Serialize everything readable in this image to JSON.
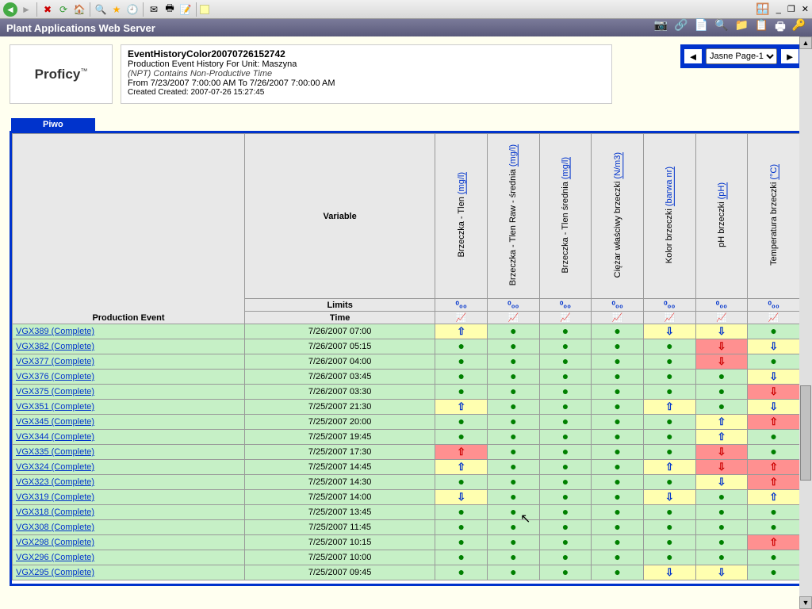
{
  "toolbar": {
    "back": "◄",
    "fwd": "►",
    "stop": "✖",
    "refresh": "⟳",
    "home": "🏠",
    "search": "🔍",
    "fav": "★",
    "hist": "🕘",
    "mail": "✉",
    "print": "🖶",
    "edit": "📝",
    "note": "▢"
  },
  "titlebar": {
    "text": "Plant Applications Web Server",
    "icons": [
      "📷",
      "🔗",
      "📄",
      "🔍",
      "📁",
      "📋",
      "🖶",
      "🔑"
    ]
  },
  "logo": "Proficy",
  "meta": {
    "title": "EventHistoryColor20070726152742",
    "line1": "Production Event History For Unit: Maszyna",
    "line2": "(NPT) Contains Non-Productive Time",
    "line3": "From 7/23/2007 7:00:00 AM To 7/26/2007 7:00:00 AM",
    "line4": "Created Created: 2007-07-26 15:27:45"
  },
  "pager": {
    "selected": "Jasne Page-1"
  },
  "tab": "Piwo",
  "headers": {
    "variable": "Variable",
    "limits": "Limits",
    "prod_event": "Production Event",
    "time": "Time",
    "cols": [
      {
        "name": "Brzeczka - Tlen",
        "unit": "(mg/l)"
      },
      {
        "name": "Brzeczka - Tlen Raw - średnia",
        "unit": "(mg/l)"
      },
      {
        "name": "Brzeczka - Tlen średnia",
        "unit": "(mg/l)"
      },
      {
        "name": "Ciężar właściwy brzeczki",
        "unit": "(N/m3)"
      },
      {
        "name": "Kolor brzeczki",
        "unit": "(barwa nr)"
      },
      {
        "name": "pH brzeczki",
        "unit": "(pH)"
      },
      {
        "name": "Temperatura brzeczki",
        "unit": "(°C)"
      }
    ],
    "lim_icon": "⁰₀₀",
    "chart_icon": "📈"
  },
  "rows": [
    {
      "ev": "VGX389 (Complete)",
      "tm": "7/26/2007 07:00",
      "c": [
        [
          "y",
          "u"
        ],
        [
          "g",
          "d"
        ],
        [
          "g",
          "d"
        ],
        [
          "g",
          "d"
        ],
        [
          "y",
          "v"
        ],
        [
          "y",
          "v"
        ],
        [
          "g",
          "d"
        ]
      ]
    },
    {
      "ev": "VGX382 (Complete)",
      "tm": "7/26/2007 05:15",
      "c": [
        [
          "g",
          "d"
        ],
        [
          "g",
          "d"
        ],
        [
          "g",
          "d"
        ],
        [
          "g",
          "d"
        ],
        [
          "g",
          "d"
        ],
        [
          "r",
          "r"
        ],
        [
          "y",
          "v"
        ]
      ]
    },
    {
      "ev": "VGX377 (Complete)",
      "tm": "7/26/2007 04:00",
      "c": [
        [
          "g",
          "d"
        ],
        [
          "g",
          "d"
        ],
        [
          "g",
          "d"
        ],
        [
          "g",
          "d"
        ],
        [
          "g",
          "d"
        ],
        [
          "r",
          "r"
        ],
        [
          "g",
          "d"
        ]
      ]
    },
    {
      "ev": "VGX376 (Complete)",
      "tm": "7/26/2007 03:45",
      "c": [
        [
          "g",
          "d"
        ],
        [
          "g",
          "d"
        ],
        [
          "g",
          "d"
        ],
        [
          "g",
          "d"
        ],
        [
          "g",
          "d"
        ],
        [
          "g",
          "d"
        ],
        [
          "y",
          "v"
        ]
      ]
    },
    {
      "ev": "VGX375 (Complete)",
      "tm": "7/26/2007 03:30",
      "c": [
        [
          "g",
          "d"
        ],
        [
          "g",
          "d"
        ],
        [
          "g",
          "d"
        ],
        [
          "g",
          "d"
        ],
        [
          "g",
          "d"
        ],
        [
          "g",
          "d"
        ],
        [
          "r",
          "r"
        ]
      ]
    },
    {
      "ev": "VGX351 (Complete)",
      "tm": "7/25/2007 21:30",
      "c": [
        [
          "y",
          "u"
        ],
        [
          "g",
          "d"
        ],
        [
          "g",
          "d"
        ],
        [
          "g",
          "d"
        ],
        [
          "y",
          "u"
        ],
        [
          "g",
          "d"
        ],
        [
          "y",
          "v"
        ]
      ]
    },
    {
      "ev": "VGX345 (Complete)",
      "tm": "7/25/2007 20:00",
      "c": [
        [
          "g",
          "d"
        ],
        [
          "g",
          "d"
        ],
        [
          "g",
          "d"
        ],
        [
          "g",
          "d"
        ],
        [
          "g",
          "d"
        ],
        [
          "y",
          "u"
        ],
        [
          "r",
          "ru"
        ]
      ]
    },
    {
      "ev": "VGX344 (Complete)",
      "tm": "7/25/2007 19:45",
      "c": [
        [
          "g",
          "d"
        ],
        [
          "g",
          "d"
        ],
        [
          "g",
          "d"
        ],
        [
          "g",
          "d"
        ],
        [
          "g",
          "d"
        ],
        [
          "y",
          "u"
        ],
        [
          "g",
          "d"
        ]
      ]
    },
    {
      "ev": "VGX335 (Complete)",
      "tm": "7/25/2007 17:30",
      "c": [
        [
          "r",
          "ru"
        ],
        [
          "g",
          "d"
        ],
        [
          "g",
          "d"
        ],
        [
          "g",
          "d"
        ],
        [
          "g",
          "d"
        ],
        [
          "r",
          "r"
        ],
        [
          "g",
          "d"
        ]
      ]
    },
    {
      "ev": "VGX324 (Complete)",
      "tm": "7/25/2007 14:45",
      "c": [
        [
          "y",
          "u"
        ],
        [
          "g",
          "d"
        ],
        [
          "g",
          "d"
        ],
        [
          "g",
          "d"
        ],
        [
          "y",
          "u"
        ],
        [
          "r",
          "r"
        ],
        [
          "r",
          "ru"
        ]
      ]
    },
    {
      "ev": "VGX323 (Complete)",
      "tm": "7/25/2007 14:30",
      "c": [
        [
          "g",
          "d"
        ],
        [
          "g",
          "d"
        ],
        [
          "g",
          "d"
        ],
        [
          "g",
          "d"
        ],
        [
          "g",
          "d"
        ],
        [
          "y",
          "v"
        ],
        [
          "r",
          "ru"
        ]
      ]
    },
    {
      "ev": "VGX319 (Complete)",
      "tm": "7/25/2007 14:00",
      "c": [
        [
          "y",
          "v"
        ],
        [
          "g",
          "d"
        ],
        [
          "g",
          "d"
        ],
        [
          "g",
          "d"
        ],
        [
          "y",
          "v"
        ],
        [
          "g",
          "d"
        ],
        [
          "y",
          "u"
        ]
      ]
    },
    {
      "ev": "VGX318 (Complete)",
      "tm": "7/25/2007 13:45",
      "c": [
        [
          "g",
          "d"
        ],
        [
          "g",
          "d"
        ],
        [
          "g",
          "d"
        ],
        [
          "g",
          "d"
        ],
        [
          "g",
          "d"
        ],
        [
          "g",
          "d"
        ],
        [
          "g",
          "d"
        ]
      ]
    },
    {
      "ev": "VGX308 (Complete)",
      "tm": "7/25/2007 11:45",
      "c": [
        [
          "g",
          "d"
        ],
        [
          "g",
          "d"
        ],
        [
          "g",
          "d"
        ],
        [
          "g",
          "d"
        ],
        [
          "g",
          "d"
        ],
        [
          "g",
          "d"
        ],
        [
          "g",
          "d"
        ]
      ]
    },
    {
      "ev": "VGX298 (Complete)",
      "tm": "7/25/2007 10:15",
      "c": [
        [
          "g",
          "d"
        ],
        [
          "g",
          "d"
        ],
        [
          "g",
          "d"
        ],
        [
          "g",
          "d"
        ],
        [
          "g",
          "d"
        ],
        [
          "g",
          "d"
        ],
        [
          "r",
          "ru"
        ]
      ]
    },
    {
      "ev": "VGX296 (Complete)",
      "tm": "7/25/2007 10:00",
      "c": [
        [
          "g",
          "d"
        ],
        [
          "g",
          "d"
        ],
        [
          "g",
          "d"
        ],
        [
          "g",
          "d"
        ],
        [
          "g",
          "d"
        ],
        [
          "g",
          "d"
        ],
        [
          "g",
          "d"
        ]
      ]
    },
    {
      "ev": "VGX295 (Complete)",
      "tm": "7/25/2007 09:45",
      "c": [
        [
          "g",
          "d"
        ],
        [
          "g",
          "d"
        ],
        [
          "g",
          "d"
        ],
        [
          "g",
          "d"
        ],
        [
          "y",
          "v"
        ],
        [
          "y",
          "v"
        ],
        [
          "g",
          "d"
        ]
      ]
    }
  ]
}
